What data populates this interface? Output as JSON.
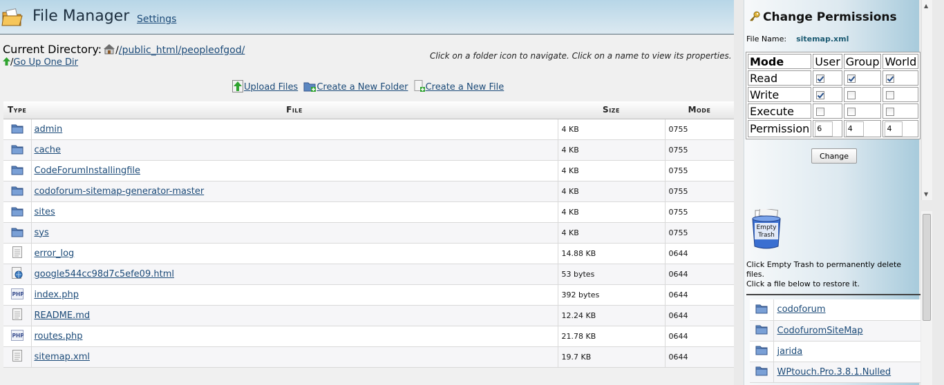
{
  "header": {
    "title": "File Manager",
    "settings_link": "Settings"
  },
  "current_dir": {
    "label": "Current Directory:",
    "path": "/public_html/peopleofgod/",
    "separator": "/",
    "go_up": "Go Up One Dir"
  },
  "hint": "Click on a folder icon to navigate. Click on a name to view its properties.",
  "actions": {
    "upload": "Upload Files",
    "new_folder": "Create a New Folder",
    "new_file": "Create a New File"
  },
  "table": {
    "headers": {
      "type": "Type",
      "file": "File",
      "size": "Size",
      "mode": "Mode"
    },
    "rows": [
      {
        "icon": "folder-icon",
        "name": "admin",
        "size": "4 KB",
        "mode": "0755"
      },
      {
        "icon": "folder-icon",
        "name": "cache",
        "size": "4 KB",
        "mode": "0755"
      },
      {
        "icon": "folder-icon",
        "name": "CodeForumInstallingfile",
        "size": "4 KB",
        "mode": "0755"
      },
      {
        "icon": "folder-icon",
        "name": "codoforum-sitemap-generator-master",
        "size": "4 KB",
        "mode": "0755"
      },
      {
        "icon": "folder-icon",
        "name": "sites",
        "size": "4 KB",
        "mode": "0755"
      },
      {
        "icon": "folder-icon",
        "name": "sys",
        "size": "4 KB",
        "mode": "0755"
      },
      {
        "icon": "text-file-icon",
        "name": "error_log",
        "size": "14.88 KB",
        "mode": "0644"
      },
      {
        "icon": "html-file-icon",
        "name": "google544cc98d7c5efe09.html",
        "size": "53 bytes",
        "mode": "0644"
      },
      {
        "icon": "php-file-icon",
        "name": "index.php",
        "size": "392 bytes",
        "mode": "0644"
      },
      {
        "icon": "text-file-icon",
        "name": "README.md",
        "size": "12.24 KB",
        "mode": "0644"
      },
      {
        "icon": "php-file-icon",
        "name": "routes.php",
        "size": "21.78 KB",
        "mode": "0644"
      },
      {
        "icon": "text-file-icon",
        "name": "sitemap.xml",
        "size": "19.7 KB",
        "mode": "0644"
      }
    ]
  },
  "permissions": {
    "title": "Change Permissions",
    "file_name_label": "File Name:",
    "file_name": "sitemap.xml",
    "headers": {
      "mode": "Mode",
      "user": "User",
      "group": "Group",
      "world": "World"
    },
    "rows": [
      {
        "label": "Read",
        "user": true,
        "group": true,
        "world": true
      },
      {
        "label": "Write",
        "user": true,
        "group": false,
        "world": false
      },
      {
        "label": "Execute",
        "user": false,
        "group": false,
        "world": false
      }
    ],
    "permission_label": "Permission",
    "values": {
      "user": "6",
      "group": "4",
      "world": "4"
    },
    "change_button": "Change"
  },
  "trash": {
    "label_line1": "Empty",
    "label_line2": "Trash",
    "info_line1": "Click Empty Trash to permanently delete files.",
    "info_line2": "Click a file below to restore it.",
    "items": [
      "codoforum",
      "CodofuromSiteMap",
      "jarida",
      "WPtouch.Pro.3.8.1.Nulled"
    ]
  }
}
